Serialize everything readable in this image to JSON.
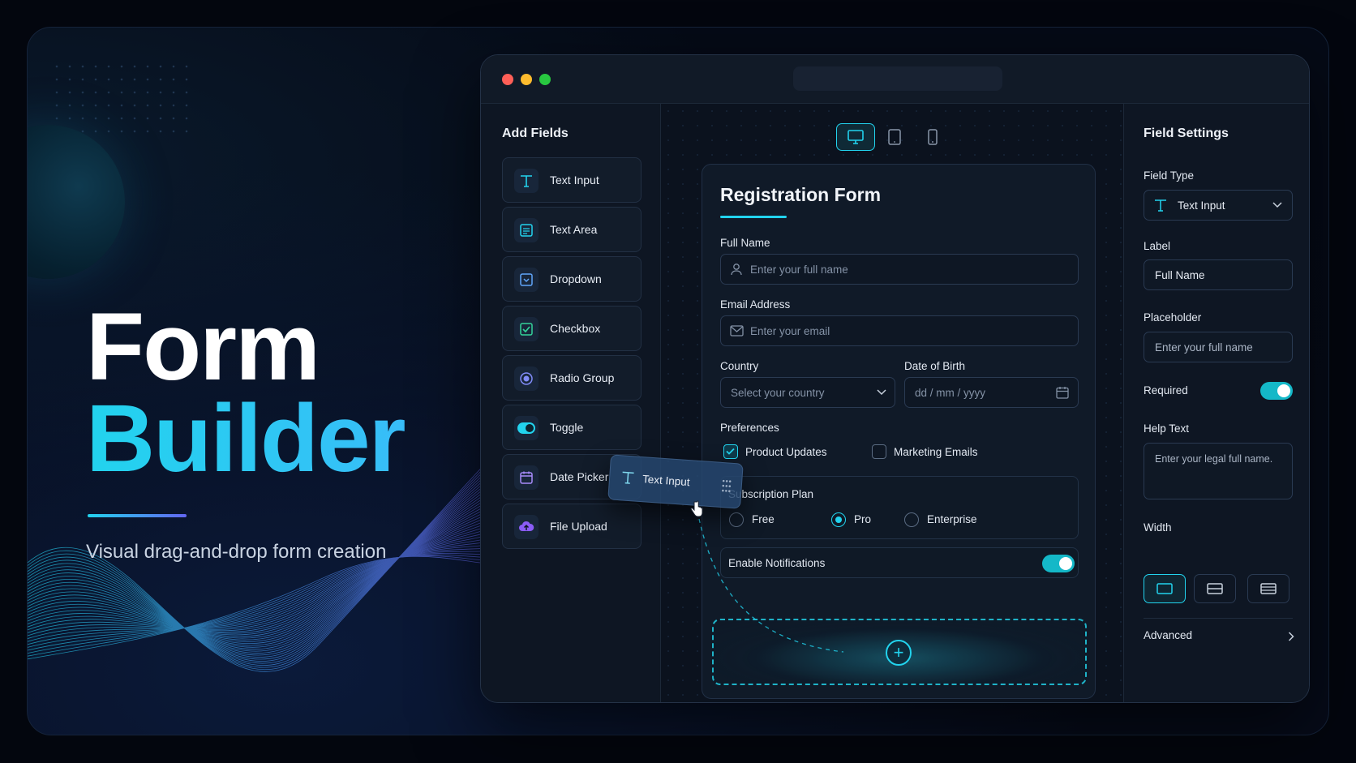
{
  "hero": {
    "line1": "Form",
    "line2": "Builder",
    "subtitle": "Visual drag-and-drop form creation"
  },
  "left_panel": {
    "title": "Add Fields",
    "items": [
      {
        "label": "Text Input",
        "icon": "text-icon"
      },
      {
        "label": "Text Area",
        "icon": "textarea-icon"
      },
      {
        "label": "Dropdown",
        "icon": "dropdown-icon"
      },
      {
        "label": "Checkbox",
        "icon": "checkbox-icon"
      },
      {
        "label": "Radio Group",
        "icon": "radio-icon"
      },
      {
        "label": "Toggle",
        "icon": "toggle-icon"
      },
      {
        "label": "Date Picker",
        "icon": "calendar-icon"
      },
      {
        "label": "File Upload",
        "icon": "upload-icon"
      }
    ]
  },
  "drag_ghost": {
    "label": "Text Input"
  },
  "device_toggle": {
    "active": "desktop",
    "options": [
      "desktop",
      "tablet",
      "mobile"
    ]
  },
  "form": {
    "title": "Registration Form",
    "full_name": {
      "label": "Full Name",
      "placeholder": "Enter your full name"
    },
    "email": {
      "label": "Email Address",
      "placeholder": "Enter your email"
    },
    "country": {
      "label": "Country",
      "placeholder": "Select your country"
    },
    "dob": {
      "label": "Date of Birth",
      "placeholder": "dd / mm / yyyy"
    },
    "preferences": {
      "label": "Preferences",
      "options": [
        {
          "label": "Product Updates",
          "checked": true
        },
        {
          "label": "Marketing Emails",
          "checked": false
        }
      ]
    },
    "plan": {
      "label": "Subscription Plan",
      "options": [
        {
          "label": "Free",
          "selected": false
        },
        {
          "label": "Pro",
          "selected": true
        },
        {
          "label": "Enterprise",
          "selected": false
        }
      ]
    },
    "notifications": {
      "label": "Enable Notifications",
      "enabled": true
    }
  },
  "settings": {
    "title": "Field Settings",
    "field_type_label": "Field Type",
    "field_type_value": "Text Input",
    "label_label": "Label",
    "label_value": "Full Name",
    "placeholder_label": "Placeholder",
    "placeholder_value": "Enter your full name",
    "required_label": "Required",
    "required": true,
    "help_label": "Help Text",
    "help_value": "Enter your legal full name.",
    "width_label": "Width",
    "advanced_label": "Advanced"
  },
  "colors": {
    "accent": "#22d3ee",
    "background": "#03060e",
    "panel": "#0e1623"
  }
}
